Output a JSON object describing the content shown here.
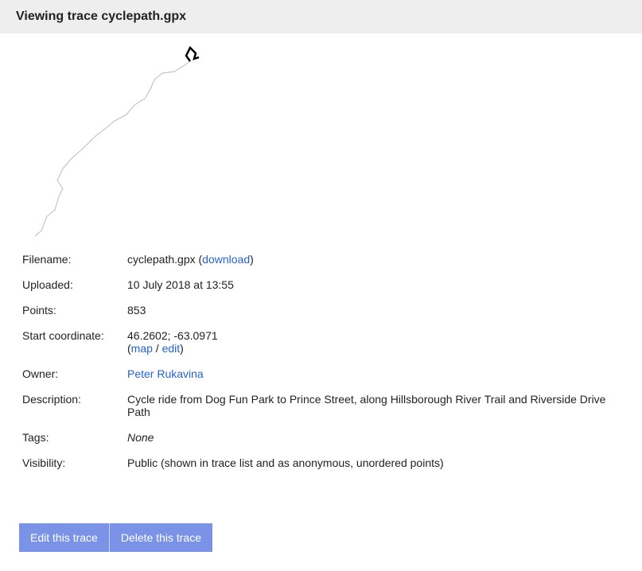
{
  "header": {
    "prefix": "Viewing trace ",
    "trace_name": "cyclepath.gpx"
  },
  "labels": {
    "filename": "Filename:",
    "uploaded": "Uploaded:",
    "points": "Points:",
    "start_coord": "Start coordinate:",
    "owner": "Owner:",
    "description": "Description:",
    "tags": "Tags:",
    "visibility": "Visibility:"
  },
  "data": {
    "filename": "cyclepath.gpx",
    "download_label": "download",
    "uploaded": "10 July 2018 at 13:55",
    "points": "853",
    "start_coord": "46.2602; -63.0971",
    "map_label": "map",
    "edit_label": "edit",
    "owner": "Peter Rukavina",
    "description": "Cycle ride from Dog Fun Park to Prince Street, along Hillsborough River Trail and Riverside Drive Path",
    "tags": "None",
    "visibility": "Public (shown in trace list and as anonymous, unordered points)"
  },
  "links_sep": " / ",
  "paren_open": "(",
  "paren_close": ")",
  "space": " ",
  "buttons": {
    "edit": "Edit this trace",
    "delete": "Delete this trace"
  }
}
